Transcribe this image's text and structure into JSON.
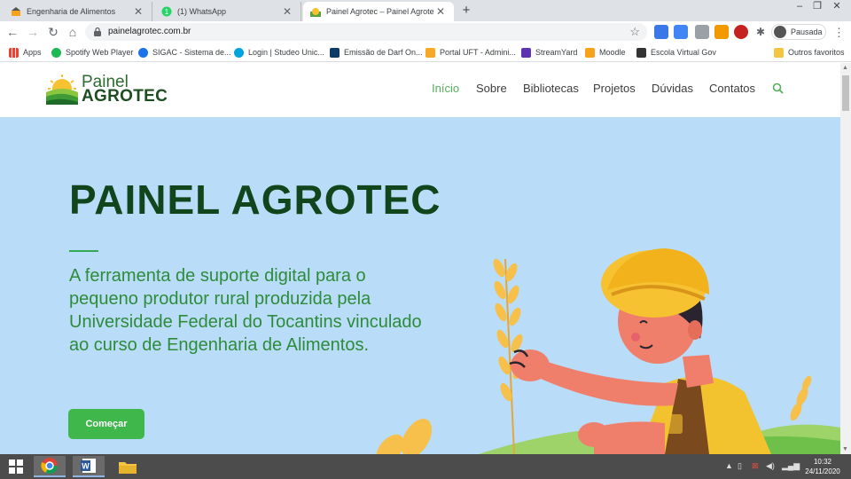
{
  "browser": {
    "tabs": [
      {
        "title": "Engenharia de Alimentos",
        "active": false
      },
      {
        "title": "(1) WhatsApp",
        "active": false
      },
      {
        "title": "Painel Agrotec – Painel Agrotec",
        "active": true
      }
    ],
    "new_tab_label": "+",
    "url": "painelagrotec.com.br",
    "profile_label": "Pausada",
    "bookmarks": [
      {
        "label": "Apps"
      },
      {
        "label": "Spotify Web Player"
      },
      {
        "label": "SIGAC - Sistema de..."
      },
      {
        "label": "Login | Studeo Unic..."
      },
      {
        "label": "Emissão de Darf On..."
      },
      {
        "label": "Portal UFT - Admini..."
      },
      {
        "label": "StreamYard"
      },
      {
        "label": "Moodle"
      },
      {
        "label": "Escola Virtual Gov"
      }
    ],
    "other_bookmarks": "Outros favoritos"
  },
  "site": {
    "logo": {
      "line1": "Painel",
      "line2": "AGROTEC"
    },
    "nav": [
      {
        "label": "Início",
        "active": true
      },
      {
        "label": "Sobre",
        "active": false
      },
      {
        "label": "Bibliotecas",
        "active": false
      },
      {
        "label": "Projetos",
        "active": false
      },
      {
        "label": "Dúvidas",
        "active": false
      },
      {
        "label": "Contatos",
        "active": false
      }
    ],
    "hero": {
      "title": "PAINEL AGROTEC",
      "description": "A ferramenta de suporte digital para o pequeno produtor rural produzida pela Universidade Federal do Tocantins vinculado ao curso de Engenharia de Alimentos.",
      "cta": "Começar"
    },
    "colors": {
      "accent": "#52b05a",
      "hero_bg": "#b9ddf8",
      "title": "#11461c",
      "cta_bg": "#3fb74b"
    }
  },
  "taskbar": {
    "time": "10:32",
    "date": "24/11/2020"
  }
}
